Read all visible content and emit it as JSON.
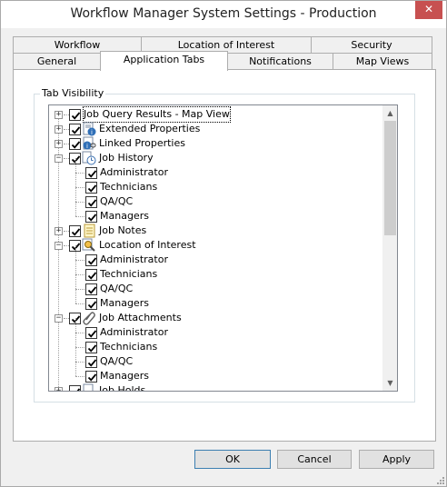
{
  "window": {
    "title": "Workflow Manager System Settings - Production",
    "close_glyph": "✕"
  },
  "tabs": {
    "back_row": [
      "Workflow",
      "Location of Interest",
      "Security"
    ],
    "front_row": [
      "General",
      "Application Tabs",
      "Notifications",
      "Map Views"
    ],
    "active": "Application Tabs"
  },
  "group": {
    "label": "Tab Visibility"
  },
  "tree": [
    {
      "label": "Job Query Results - Map View",
      "level": 0,
      "expander": "+",
      "checked": true,
      "icon": "",
      "selected": true
    },
    {
      "label": "Extended Properties",
      "level": 0,
      "expander": "+",
      "checked": true,
      "icon": "info-list-icon"
    },
    {
      "label": "Linked Properties",
      "level": 0,
      "expander": "+",
      "checked": true,
      "icon": "info-link-icon"
    },
    {
      "label": "Job History",
      "level": 0,
      "expander": "−",
      "checked": true,
      "icon": "clock-document-icon"
    },
    {
      "label": "Administrator",
      "level": 1,
      "checked": true
    },
    {
      "label": "Technicians",
      "level": 1,
      "checked": true
    },
    {
      "label": "QA/QC",
      "level": 1,
      "checked": true
    },
    {
      "label": "Managers",
      "level": 1,
      "checked": true
    },
    {
      "label": "Job Notes",
      "level": 0,
      "expander": "+",
      "checked": true,
      "icon": "notes-icon"
    },
    {
      "label": "Location of Interest",
      "level": 0,
      "expander": "−",
      "checked": true,
      "icon": "map-search-icon"
    },
    {
      "label": "Administrator",
      "level": 1,
      "checked": true
    },
    {
      "label": "Technicians",
      "level": 1,
      "checked": true
    },
    {
      "label": "QA/QC",
      "level": 1,
      "checked": true
    },
    {
      "label": "Managers",
      "level": 1,
      "checked": true
    },
    {
      "label": "Job Attachments",
      "level": 0,
      "expander": "−",
      "checked": true,
      "icon": "paperclip-icon"
    },
    {
      "label": "Administrator",
      "level": 1,
      "checked": true
    },
    {
      "label": "Technicians",
      "level": 1,
      "checked": true
    },
    {
      "label": "QA/QC",
      "level": 1,
      "checked": true
    },
    {
      "label": "Managers",
      "level": 1,
      "checked": true
    },
    {
      "label": "Job Holds",
      "level": 0,
      "expander": "+",
      "checked": true,
      "icon": "hold-document-icon"
    }
  ],
  "scrollbar": {
    "up_glyph": "▲",
    "down_glyph": "▼"
  },
  "buttons": {
    "ok": "OK",
    "cancel": "Cancel",
    "apply": "Apply"
  },
  "colors": {
    "close": "#c75050",
    "default_button_border": "#3c7fb1"
  }
}
